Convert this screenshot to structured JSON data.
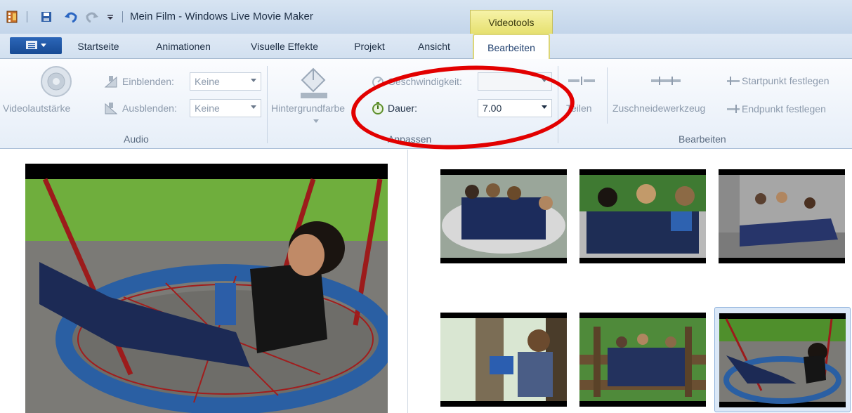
{
  "titlebar": {
    "app_title": "Mein Film - Windows Live Movie Maker",
    "context_tab": "Videotools"
  },
  "tabs": [
    "Startseite",
    "Animationen",
    "Visuelle Effekte",
    "Projekt",
    "Ansicht",
    "Bearbeiten"
  ],
  "active_tab": "Bearbeiten",
  "audio": {
    "video_volume_label": "Videolautstärke",
    "fade_in_label": "Einblenden:",
    "fade_in_value": "Keine",
    "fade_out_label": "Ausblenden:",
    "fade_out_value": "Keine",
    "group_label": "Audio"
  },
  "adjust": {
    "background_color_label": "Hintergrundfarbe",
    "speed_label": "Geschwindigkeit:",
    "duration_label": "Dauer:",
    "duration_value": "7.00",
    "group_label": "Anpassen"
  },
  "edit": {
    "split_label": "Teilen",
    "trim_label": "Zuschneidewerkzeug",
    "start_point_label": "Startpunkt festlegen",
    "end_point_label": "Endpunkt festlegen",
    "group_label": "Bearbeiten"
  },
  "icons": [
    "film-icon",
    "save-icon",
    "undo-icon",
    "redo-icon",
    "customize-dropdown-icon",
    "app-menu-icon",
    "speaker-icon",
    "fade-in-icon",
    "fade-out-icon",
    "paint-bucket-icon",
    "speed-icon",
    "stopwatch-icon",
    "split-icon",
    "trim-icon",
    "start-point-icon",
    "end-point-icon"
  ],
  "colors": {
    "ribbon_bg": "#eef3fa",
    "context_tab": "#f2ee9a",
    "annotation": "#e20000",
    "app_menu": "#1f58a8"
  }
}
